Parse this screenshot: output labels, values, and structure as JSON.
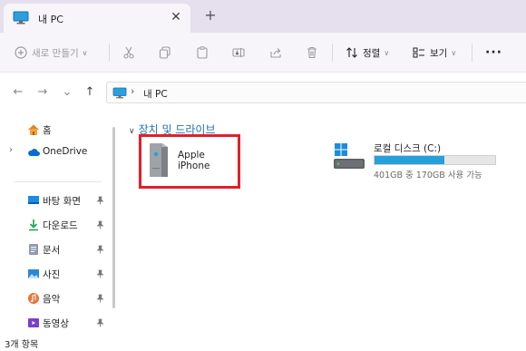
{
  "tab": {
    "title": "내 PC",
    "icon": "monitor-icon",
    "close_glyph": "✕",
    "new_tab_glyph": "+"
  },
  "toolbar": {
    "new_label": "새로 만들기",
    "sort_label": "정렬",
    "view_label": "보기",
    "more_glyph": "···",
    "icons": [
      "plus-circle-icon",
      "cut-icon",
      "copy-icon",
      "paste-icon",
      "rename-icon",
      "share-icon",
      "delete-icon",
      "sort-icon",
      "view-icon",
      "more-icon"
    ]
  },
  "nav": {
    "back_glyph": "←",
    "forward_glyph": "→",
    "recent_glyph": "⌄",
    "up_glyph": "↑",
    "breadcrumb_sep": "›",
    "breadcrumb": "내 PC"
  },
  "sidebar": {
    "items": [
      {
        "label": "홈",
        "icon": "home-icon",
        "expand": ""
      },
      {
        "label": "OneDrive",
        "icon": "cloud-icon",
        "expand": "›"
      },
      {
        "label": "바탕 화면",
        "icon": "desktop-icon",
        "pinned": true
      },
      {
        "label": "다운로드",
        "icon": "download-icon",
        "pinned": true
      },
      {
        "label": "문서",
        "icon": "document-icon",
        "pinned": true
      },
      {
        "label": "사진",
        "icon": "pictures-icon",
        "pinned": true
      },
      {
        "label": "음악",
        "icon": "music-icon",
        "pinned": true
      },
      {
        "label": "동영상",
        "icon": "video-icon",
        "pinned": true
      }
    ]
  },
  "main": {
    "group_chevron": "∨",
    "group_title": "장치 및 드라이브",
    "devices": [
      {
        "name": "Apple iPhone",
        "icon": "device-icon"
      }
    ],
    "drives": [
      {
        "name": "로컬 디스크 (C:)",
        "detail": "401GB 중 170GB 사용 가능",
        "used_fraction": 0.576,
        "icon": "drive-icon"
      }
    ]
  },
  "status": {
    "text": "3개 항목"
  },
  "colors": {
    "accent": "#26a0da",
    "highlight_border": "#e0202a",
    "titlebar": "#e6dfee",
    "group_header": "#1f6fb5"
  }
}
